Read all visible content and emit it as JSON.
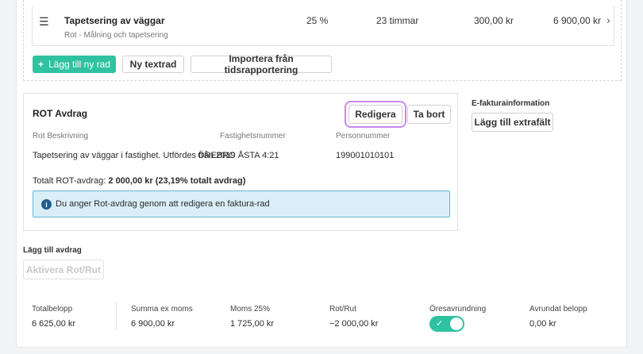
{
  "invoice_row": {
    "title": "Tapetsering av väggar",
    "subtitle": "Rot - Målning och tapetsering",
    "discount": "25 %",
    "quantity": "23 timmar",
    "price": "300,00 kr",
    "total": "6 900,00 kr"
  },
  "row_actions": {
    "add_row": "Lägg till ny rad",
    "new_textrow": "Ny textrad",
    "import": "Importera från tidsrapportering"
  },
  "rot": {
    "title": "ROT Avdrag",
    "edit_label": "Redigera",
    "remove_label": "Ta bort",
    "columns": {
      "description": "Rot Beskrivning",
      "property": "Fastighetsnummer",
      "person": "Personnummer"
    },
    "values": {
      "description": "Tapetsering av väggar i fastighet. Utfördes från 2019",
      "property": "ÖREBRO ÅSTA 4:21",
      "person": "199001010101"
    },
    "total_prefix": "Totalt ROT-avdrag:",
    "total_value": "2 000,00 kr (23,19% totalt avdrag)",
    "info": "Du anger Rot-avdrag genom att redigera en faktura-rad"
  },
  "efaktura": {
    "label": "E-fakturainformation",
    "button": "Lägg till extrafält"
  },
  "deduction": {
    "label": "Lägg till avdrag",
    "button": "Aktivera Rot/Rut"
  },
  "summary": {
    "total_label": "Totalbelopp",
    "total_value": "6 625,00 kr",
    "ex_vat_label": "Summa ex moms",
    "ex_vat_value": "6 900,00 kr",
    "vat_label": "Moms 25%",
    "vat_value": "1 725,00 kr",
    "rotrut_label": "Rot/Rut",
    "rotrut_value": "−2 000,00 kr",
    "rounding_label": "Öresavrundning",
    "rounding_on": true,
    "rounded_label": "Avrundat belopp",
    "rounded_value": "0,00 kr"
  },
  "colors": {
    "accent": "#2fc2a0",
    "info_bg": "#d9eef7",
    "info_border": "#66b7d6",
    "highlight": "#c58bef"
  }
}
